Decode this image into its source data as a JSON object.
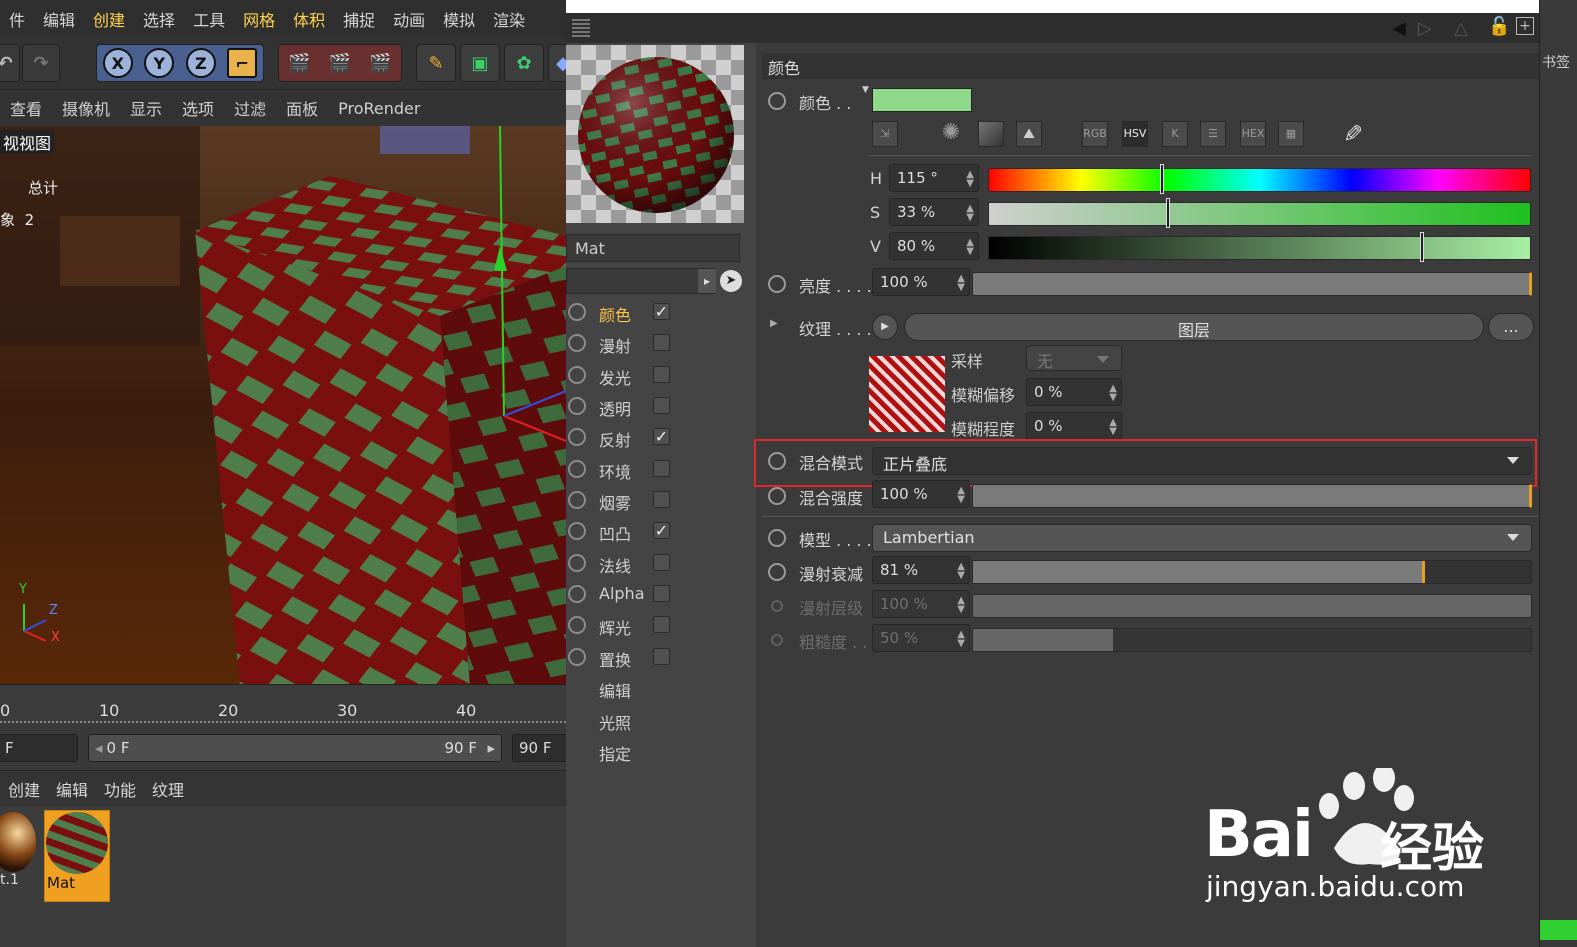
{
  "menubar": {
    "items": [
      "件",
      "编辑",
      "创建",
      "选择",
      "工具",
      "网格",
      "体积",
      "捕捉",
      "动画",
      "模拟",
      "渲染"
    ],
    "highlighted": [
      2,
      5,
      6
    ]
  },
  "viewport_menu": {
    "items": [
      "查看",
      "摄像机",
      "显示",
      "选项",
      "过滤",
      "面板",
      "ProRender"
    ]
  },
  "viewport": {
    "title": "视视图",
    "total_label": "总计",
    "object_label": "象",
    "object_count": "2",
    "axis_y": "Y",
    "axis_z": "Z",
    "axis_x": "X"
  },
  "timeline": {
    "ticks": [
      "0",
      "10",
      "20",
      "30",
      "40"
    ]
  },
  "frames": {
    "current": "F",
    "start": "0 F",
    "end_inner": "90 F",
    "end": "90 F"
  },
  "material_menu": {
    "items": [
      "创建",
      "编辑",
      "功能",
      "纹理"
    ]
  },
  "materials": [
    {
      "label": "t.1"
    },
    {
      "label": "Mat"
    }
  ],
  "material": {
    "name": "Mat"
  },
  "channels": [
    {
      "label": "颜色",
      "checked": true,
      "active": true
    },
    {
      "label": "漫射",
      "checked": false
    },
    {
      "label": "发光",
      "checked": false
    },
    {
      "label": "透明",
      "checked": false
    },
    {
      "label": "反射",
      "checked": true
    },
    {
      "label": "环境",
      "checked": false
    },
    {
      "label": "烟雾",
      "checked": false
    },
    {
      "label": "凹凸",
      "checked": true
    },
    {
      "label": "法线",
      "checked": false
    },
    {
      "label": "Alpha",
      "checked": false
    },
    {
      "label": "辉光",
      "checked": false
    },
    {
      "label": "置换",
      "checked": false
    }
  ],
  "channel_extras": [
    "编辑",
    "光照",
    "指定"
  ],
  "color_section": {
    "title": "颜色",
    "color_label": "颜色 . .",
    "swatch": "#8fd98a",
    "mode_buttons": [
      "RGB",
      "HSV",
      "K",
      "HEX"
    ],
    "h_label": "H",
    "h_value": "115 °",
    "s_label": "S",
    "s_value": "33 %",
    "v_label": "V",
    "v_value": "80 %",
    "brightness_label": "亮度 . . . .",
    "brightness_value": "100 %",
    "texture_label": "纹理 . . . .",
    "texture_button": "图层",
    "texture_more": "...",
    "sample_label": "采样",
    "sample_value": "无",
    "blur_offset_label": "模糊偏移",
    "blur_offset_value": "0 %",
    "blur_level_label": "模糊程度",
    "blur_level_value": "0 %",
    "blend_mode_label": "混合模式",
    "blend_mode_value": "正片叠底",
    "blend_strength_label": "混合强度",
    "blend_strength_value": "100 %",
    "model_label": "模型 . . . .",
    "model_value": "Lambertian",
    "diffuse_falloff_label": "漫射衰减",
    "diffuse_falloff_value": "81 %",
    "diffuse_level_label": "漫射层级",
    "diffuse_level_value": "100 %",
    "roughness_label": "粗糙度 . .",
    "roughness_value": "50 %"
  },
  "right_edge": {
    "tab": "书签"
  },
  "watermark": {
    "brand": "Bai",
    "brand2": "经验",
    "url": "jingyan.baidu.com"
  },
  "colors": {
    "highlight": "#ffd24d",
    "accent_red": "#e0262a",
    "brick_red": "#8a1010",
    "brick_green": "#4f7d4c"
  }
}
